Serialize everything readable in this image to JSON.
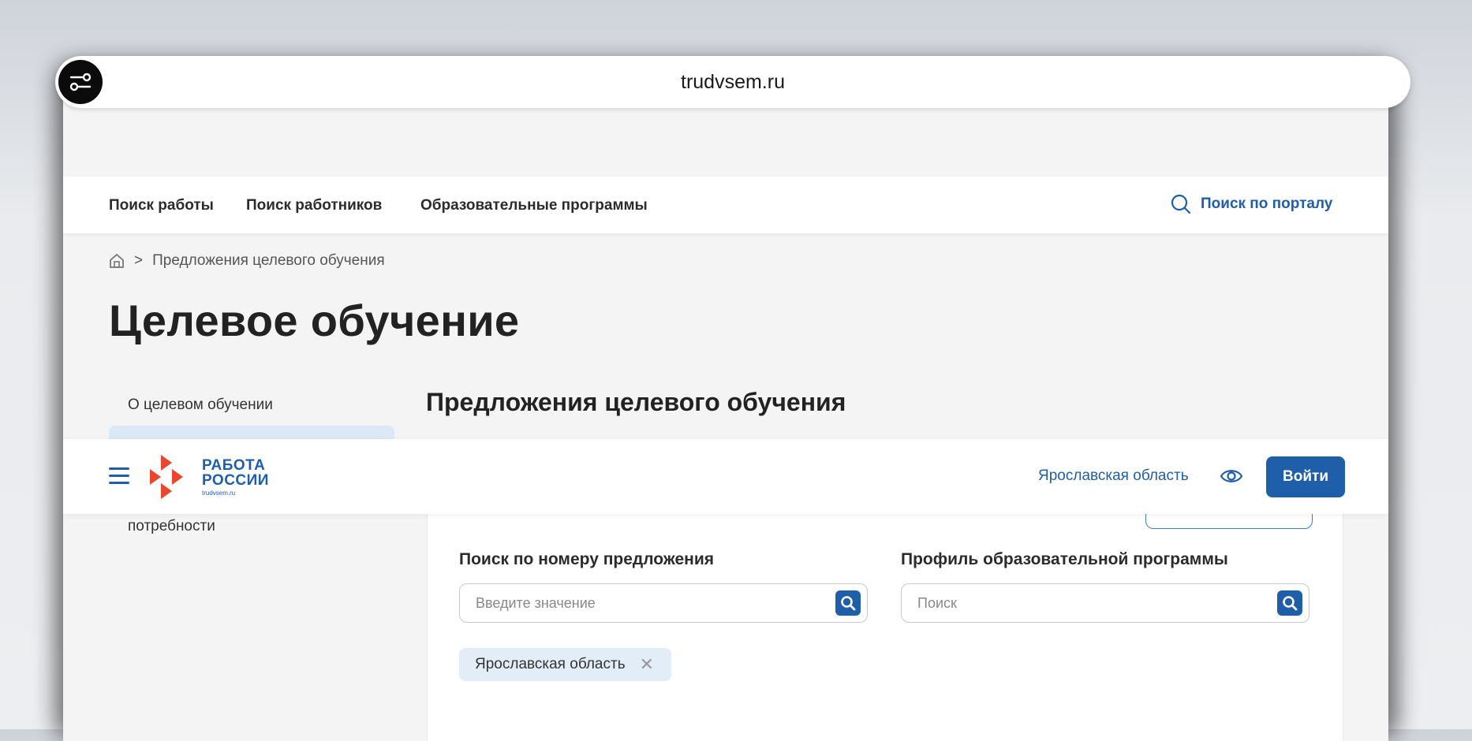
{
  "browser": {
    "url": "trudvsem.ru"
  },
  "topnav": {
    "items": [
      "Поиск работы",
      "Поиск работников",
      "Образовательные программы"
    ],
    "portal_search": "Поиск по порталу"
  },
  "breadcrumb": {
    "separator": ">",
    "current": "Предложения целевого обучения"
  },
  "page_title": "Целевое обучение",
  "sidebar": {
    "items": [
      "О целевом обучении",
      "потребности"
    ]
  },
  "section_title": "Предложения целевого обучения",
  "header": {
    "logo_line1": "РАБОТА",
    "logo_line2": "РОССИИ",
    "logo_domain": "trudvsem.ru",
    "region": "Ярославская область",
    "login": "Войти"
  },
  "filters": {
    "offer_number": {
      "label": "Поиск по номеру предложения",
      "placeholder": "Введите значение"
    },
    "profile": {
      "label": "Профиль образовательной программы",
      "placeholder": "Поиск"
    },
    "chip": {
      "label": "Ярославская область",
      "remove": "✕"
    }
  },
  "colors": {
    "brand_blue": "#1f5ea8",
    "logo_red": "#e8472d",
    "chip_bg": "#e3edf8"
  }
}
